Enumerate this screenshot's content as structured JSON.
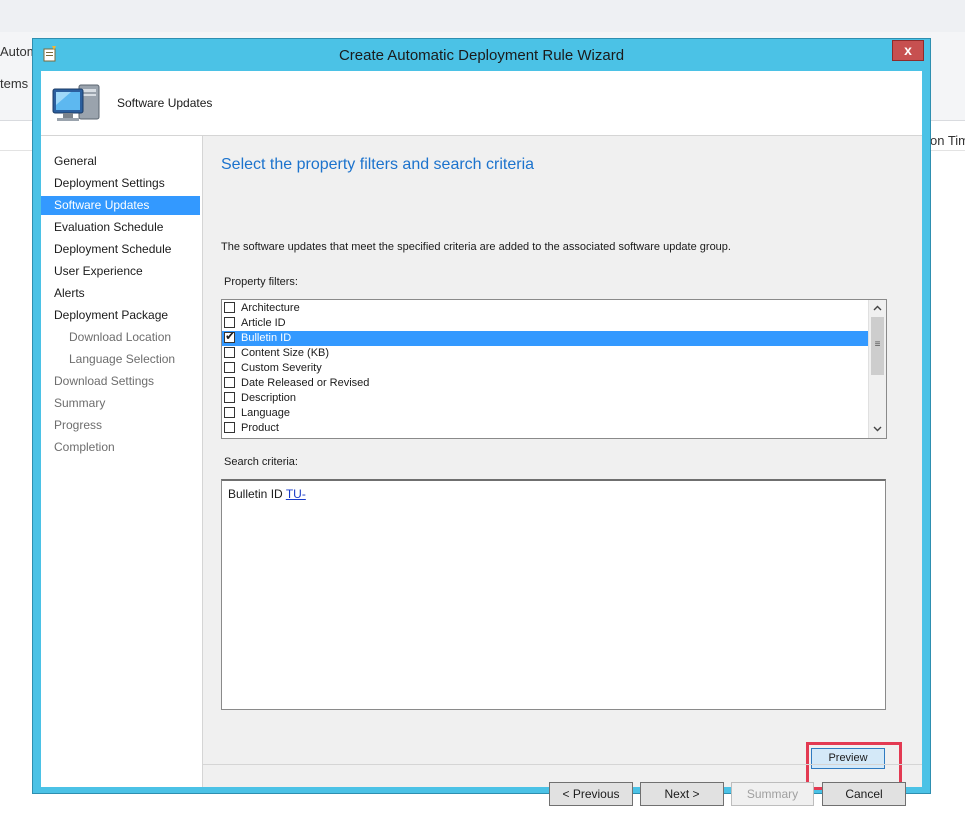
{
  "background_app": {
    "left_snippets": [
      "Autom",
      "tems"
    ],
    "right_snippet": "on Tim"
  },
  "dialog": {
    "title": "Create Automatic Deployment Rule Wizard",
    "close_glyph": "x",
    "header_title": "Software Updates"
  },
  "nav": {
    "items": [
      {
        "label": "General",
        "level": 0,
        "state": "normal"
      },
      {
        "label": "Deployment Settings",
        "level": 0,
        "state": "normal"
      },
      {
        "label": "Software Updates",
        "level": 0,
        "state": "active"
      },
      {
        "label": "Evaluation Schedule",
        "level": 0,
        "state": "normal"
      },
      {
        "label": "Deployment Schedule",
        "level": 0,
        "state": "normal"
      },
      {
        "label": "User Experience",
        "level": 0,
        "state": "normal"
      },
      {
        "label": "Alerts",
        "level": 0,
        "state": "normal"
      },
      {
        "label": "Deployment Package",
        "level": 0,
        "state": "normal"
      },
      {
        "label": "Download Location",
        "level": 1,
        "state": "disabled"
      },
      {
        "label": "Language Selection",
        "level": 1,
        "state": "disabled"
      },
      {
        "label": "Download Settings",
        "level": 0,
        "state": "disabled"
      },
      {
        "label": "Summary",
        "level": 0,
        "state": "disabled"
      },
      {
        "label": "Progress",
        "level": 0,
        "state": "disabled"
      },
      {
        "label": "Completion",
        "level": 0,
        "state": "disabled"
      }
    ]
  },
  "content": {
    "heading": "Select the property filters and search criteria",
    "description": "The software updates that meet the specified criteria are added to the associated software update group.",
    "property_filters_label": "Property filters:",
    "property_filters": [
      {
        "label": "Architecture",
        "checked": false,
        "selected": false
      },
      {
        "label": "Article ID",
        "checked": false,
        "selected": false
      },
      {
        "label": "Bulletin ID",
        "checked": true,
        "selected": true
      },
      {
        "label": "Content Size (KB)",
        "checked": false,
        "selected": false
      },
      {
        "label": "Custom Severity",
        "checked": false,
        "selected": false
      },
      {
        "label": "Date Released or Revised",
        "checked": false,
        "selected": false
      },
      {
        "label": "Description",
        "checked": false,
        "selected": false
      },
      {
        "label": "Language",
        "checked": false,
        "selected": false
      },
      {
        "label": "Product",
        "checked": false,
        "selected": false
      }
    ],
    "search_criteria_label": "Search criteria:",
    "search_criteria": {
      "prefix": "Bulletin ID",
      "link": "TU-"
    },
    "preview_label": "Preview"
  },
  "footer": {
    "previous_label": "< Previous",
    "next_label": "Next >",
    "summary_label": "Summary",
    "cancel_label": "Cancel"
  },
  "colors": {
    "frame": "#4bc2e6",
    "selection": "#3399ff",
    "heading": "#1c73cd",
    "highlight": "#e33a52",
    "close": "#c75050"
  },
  "icons": {
    "title": "wizard-icon",
    "header": "computer-icon",
    "check": "check-icon",
    "scroll_up": "chevron-up-icon",
    "scroll_down": "chevron-down-icon"
  }
}
